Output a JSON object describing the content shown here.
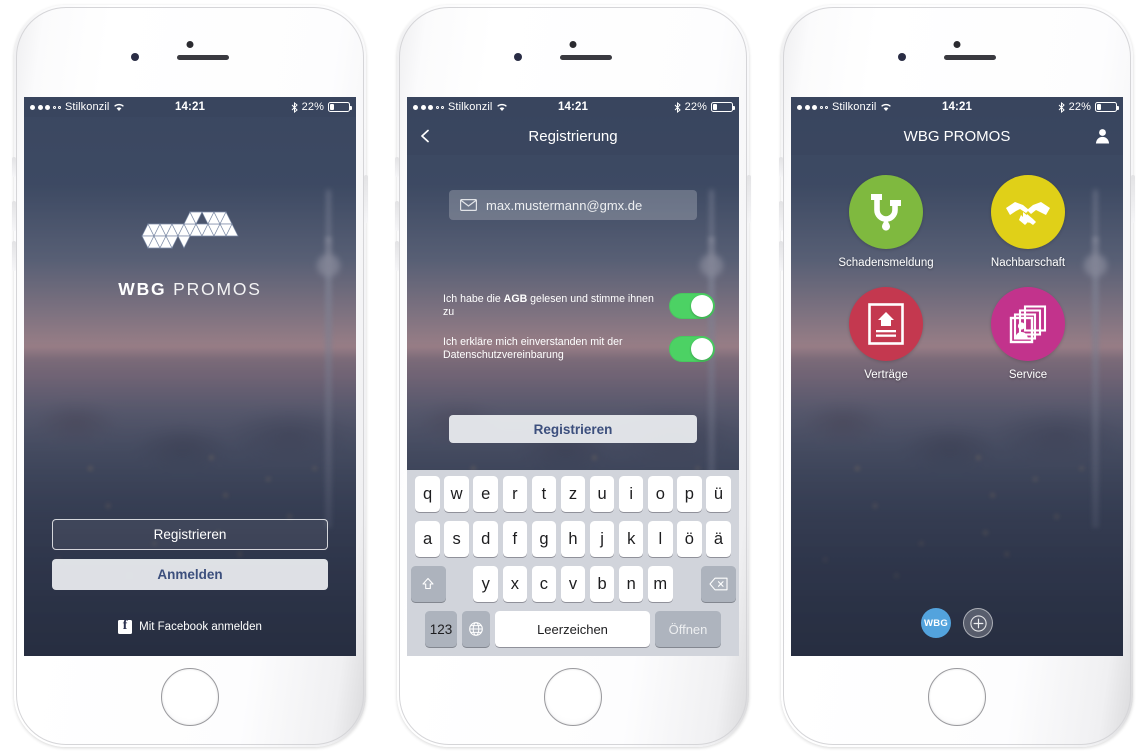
{
  "status_bar": {
    "carrier": "Stilkonzil",
    "time": "14:21",
    "battery_percent": "22%",
    "signal_dots_filled": 3,
    "signal_dots_total": 5,
    "wifi_icon": "wifi-icon",
    "bluetooth_icon": "bluetooth-icon"
  },
  "colors": {
    "accent_blue": "#3c4f7d",
    "toggle_green": "#4cd264",
    "tile_green": "#7fb93f",
    "tile_yellow": "#e0d018",
    "tile_red": "#c4384f",
    "tile_magenta": "#c2338c",
    "fab_blue": "#53a3dd"
  },
  "phone1": {
    "screen_name": "splash-login",
    "logo": {
      "mark": "wbg-promos-triangles-logo",
      "text_bold": "WBG",
      "text_light": "PROMOS"
    },
    "register_button": "Registrieren",
    "login_button": "Anmelden",
    "facebook_login": "Mit Facebook anmelden",
    "facebook_icon": "facebook-icon"
  },
  "phone2": {
    "screen_name": "registration",
    "nav": {
      "title": "Registrierung",
      "back_icon": "chevron-left-icon"
    },
    "email_field": {
      "value": "max.mustermann@gmx.de",
      "icon": "envelope-icon"
    },
    "consents": [
      {
        "text_before": "Ich habe die ",
        "text_bold": "AGB",
        "text_after": " gelesen und stimme ihnen zu",
        "toggle_state": "on"
      },
      {
        "text_before": "Ich erkläre mich einverstanden mit der Datenschutzvereinbarung",
        "text_bold": "",
        "text_after": "",
        "toggle_state": "on"
      }
    ],
    "submit_button": "Registrieren",
    "keyboard": {
      "layout": "QWERTZ (German)",
      "row1": [
        "q",
        "w",
        "e",
        "r",
        "t",
        "z",
        "u",
        "i",
        "o",
        "p",
        "ü"
      ],
      "row2": [
        "a",
        "s",
        "d",
        "f",
        "g",
        "h",
        "j",
        "k",
        "l",
        "ö",
        "ä"
      ],
      "row3": [
        "y",
        "x",
        "c",
        "v",
        "b",
        "n",
        "m"
      ],
      "shift_icon": "shift-arrow-icon",
      "backspace_icon": "backspace-icon",
      "numbers_key": "123",
      "globe_icon": "globe-icon",
      "space_key": "Leerzeichen",
      "action_key": "Öffnen"
    }
  },
  "phone3": {
    "screen_name": "dashboard",
    "nav": {
      "title": "WBG PROMOS",
      "profile_icon": "person-icon"
    },
    "tiles": [
      {
        "label": "Schadensmeldung",
        "icon": "pipe-leak-icon",
        "color": "#7fb93f"
      },
      {
        "label": "Nachbarschaft",
        "icon": "handshake-icon",
        "color": "#e0d018"
      },
      {
        "label": "Verträge",
        "icon": "document-house-icon",
        "color": "#c4384f"
      },
      {
        "label": "Service",
        "icon": "contact-cards-icon",
        "color": "#c2338c"
      }
    ],
    "fabs": [
      {
        "label": "WBG",
        "name": "wbg-badge-button"
      },
      {
        "label": "",
        "name": "add-button",
        "icon": "plus-circle-icon"
      }
    ]
  }
}
